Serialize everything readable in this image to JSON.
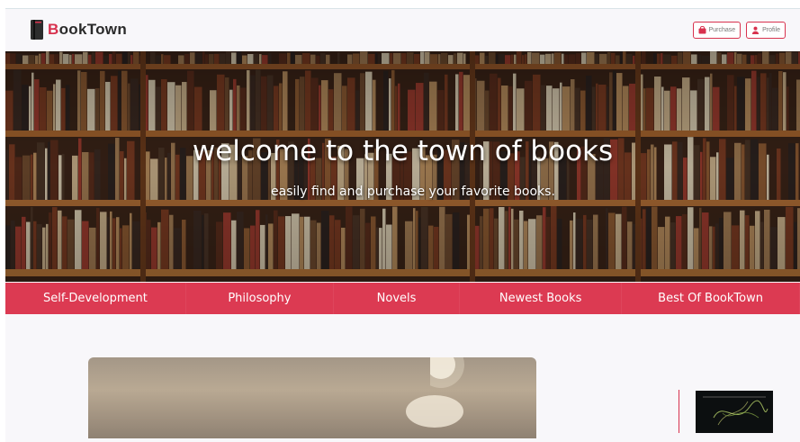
{
  "header": {
    "logo_text_first": "B",
    "logo_text_rest": "ookTown",
    "logo_icon": "book-icon",
    "buttons": [
      {
        "label": "Purchase",
        "icon": "bag-icon"
      },
      {
        "label": "Profile",
        "icon": "user-icon"
      }
    ]
  },
  "hero": {
    "title": "welcome to the town of books",
    "subtitle": "easily find and purchase your favorite books."
  },
  "nav": {
    "items": [
      {
        "label": "Self-Development"
      },
      {
        "label": "Philosophy"
      },
      {
        "label": "Novels"
      },
      {
        "label": "Newest Books"
      },
      {
        "label": "Best Of BookTown"
      }
    ]
  },
  "colors": {
    "accent": "#dc3a52",
    "page_bg": "#f8f7fa",
    "logo_text": "#2a2a2a"
  }
}
